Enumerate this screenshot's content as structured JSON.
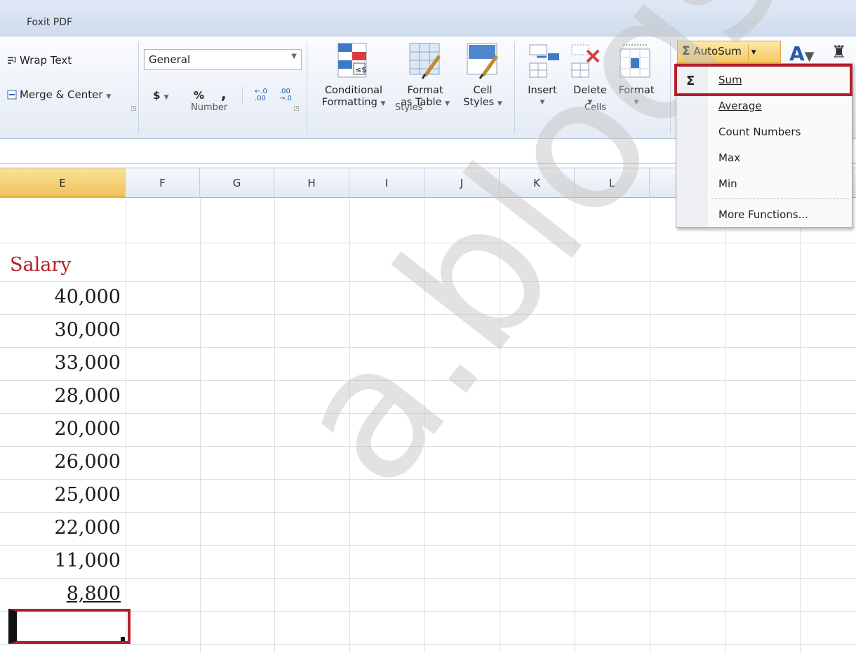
{
  "tabs": {
    "foxit": "Foxit PDF"
  },
  "alignment": {
    "wrap_text": "Wrap Text",
    "merge_center": "Merge & Center"
  },
  "number": {
    "format_value": "General",
    "currency": "$",
    "percent": "%",
    "comma": ",",
    "inc_decimal": "←.0 .00",
    "dec_decimal": ".00 →.0",
    "group_label": "Number"
  },
  "styles": {
    "conditional_l1": "Conditional",
    "conditional_l2": "Formatting",
    "format_table_l1": "Format",
    "format_table_l2": "as Table",
    "cell_styles_l1": "Cell",
    "cell_styles_l2": "Styles",
    "group_label": "Styles"
  },
  "cells": {
    "insert": "Insert",
    "delete": "Delete",
    "format": "Format",
    "group_label": "Cells"
  },
  "editing": {
    "autosum_label": "AutoSum",
    "sigma": "Σ"
  },
  "autosum_menu": {
    "items": [
      "Sum",
      "Average",
      "Count Numbers",
      "Max",
      "Min",
      "More Functions..."
    ]
  },
  "columns": [
    "E",
    "F",
    "G",
    "H",
    "I",
    "J",
    "K",
    "L"
  ],
  "active_column": "E",
  "sheet": {
    "header": "Salary",
    "values": [
      "40,000",
      "30,000",
      "33,000",
      "28,000",
      "20,000",
      "26,000",
      "25,000",
      "22,000",
      "11,000",
      "8,800"
    ]
  }
}
